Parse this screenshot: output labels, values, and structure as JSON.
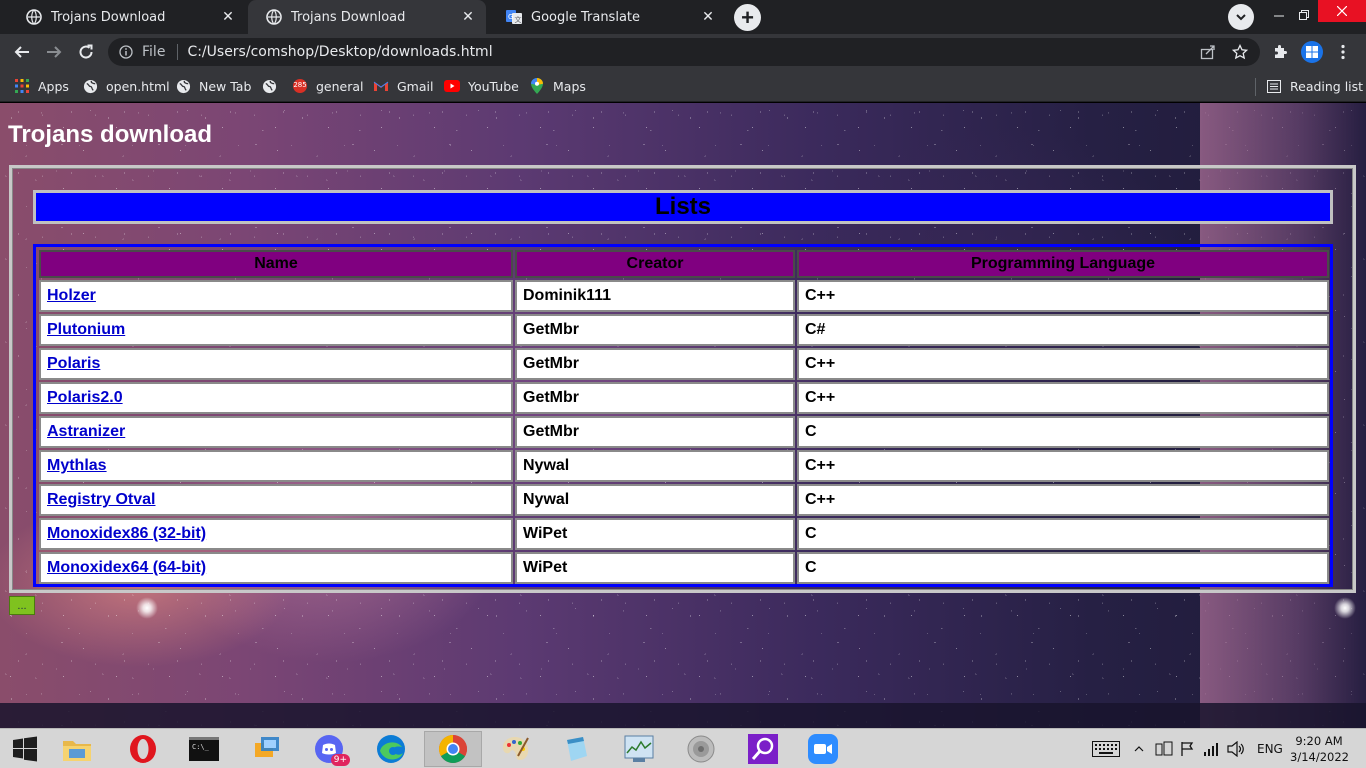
{
  "browser": {
    "tabs": [
      {
        "title": "Trojans Download",
        "active": false,
        "icon": "globe-icon"
      },
      {
        "title": "Trojans Download",
        "active": true,
        "icon": "globe-icon"
      },
      {
        "title": "Google Translate",
        "active": false,
        "icon": "google-translate-icon"
      }
    ],
    "omnibox": {
      "scheme_label": "File",
      "url": "C:/Users/comshop/Desktop/downloads.html"
    },
    "bookmarks": [
      {
        "label": "Apps",
        "icon": "apps-grid-icon"
      },
      {
        "label": "open.html",
        "icon": "globe-icon"
      },
      {
        "label": "New Tab",
        "icon": "globe-icon"
      },
      {
        "label": "",
        "icon": "globe-icon"
      },
      {
        "label": "general",
        "icon": "mail-badge-icon",
        "badge": "285"
      },
      {
        "label": "Gmail",
        "icon": "gmail-icon"
      },
      {
        "label": "YouTube",
        "icon": "youtube-icon"
      },
      {
        "label": "Maps",
        "icon": "maps-icon"
      }
    ],
    "reading_list": "Reading list"
  },
  "page": {
    "heading": "Trojans download",
    "lists_title": "Lists",
    "table": {
      "headers": [
        "Name",
        "Creator",
        "Programming Language"
      ],
      "rows": [
        {
          "name": "Holzer",
          "creator": "Dominik111",
          "language": "C++"
        },
        {
          "name": "Plutonium",
          "creator": "GetMbr",
          "language": "C#"
        },
        {
          "name": "Polaris",
          "creator": "GetMbr",
          "language": "C++"
        },
        {
          "name": "Polaris2.0",
          "creator": "GetMbr",
          "language": "C++"
        },
        {
          "name": "Astranizer",
          "creator": "GetMbr",
          "language": "C"
        },
        {
          "name": "Mythlas",
          "creator": "Nywal",
          "language": "C++"
        },
        {
          "name": "Registry Otval",
          "creator": "Nywal",
          "language": "C++"
        },
        {
          "name": "Monoxidex86 (32-bit)",
          "creator": "WiPet",
          "language": "C"
        },
        {
          "name": "Monoxidex64 (64-bit)",
          "creator": "WiPet",
          "language": "C"
        }
      ]
    },
    "more_button": "..."
  },
  "taskbar": {
    "apps": [
      "start",
      "file-explorer",
      "opera",
      "command-prompt",
      "network",
      "discord",
      "edge",
      "chrome",
      "paint",
      "notepad",
      "task-manager",
      "sound",
      "magnifier",
      "zoom"
    ],
    "discord_badge": "9+",
    "language": "ENG",
    "time": "9:20 AM",
    "date": "3/14/2022"
  },
  "colors": {
    "lists_bar": "#0000ff",
    "header_bg": "#800080",
    "link": "#0000cc",
    "more_button": "#7fc21f"
  }
}
